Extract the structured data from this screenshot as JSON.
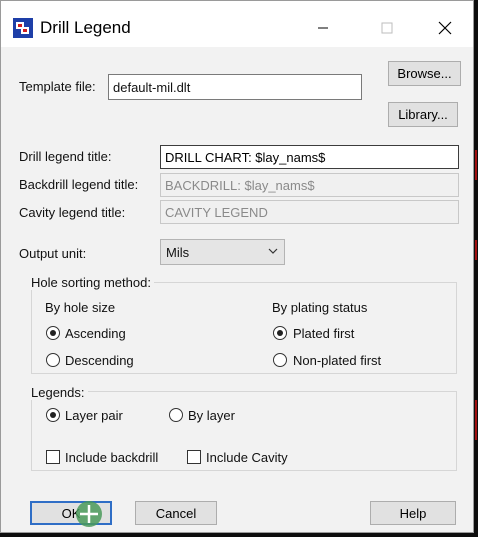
{
  "window": {
    "title": "Drill Legend",
    "minimize_icon": "minimize-icon",
    "maximize_icon": "maximize-icon",
    "close_icon": "close-icon"
  },
  "template": {
    "label": "Template file:",
    "value": "default-mil.dlt"
  },
  "buttons": {
    "browse": "Browse...",
    "library": "Library...",
    "ok": "OK",
    "cancel": "Cancel",
    "help": "Help"
  },
  "drill_legend": {
    "label": "Drill legend title:",
    "value": "DRILL CHART: $lay_nams$"
  },
  "backdrill_legend": {
    "label": "Backdrill legend title:",
    "value": "BACKDRILL: $lay_nams$"
  },
  "cavity_legend": {
    "label": "Cavity legend title:",
    "value": "CAVITY LEGEND"
  },
  "output_unit": {
    "label": "Output unit:",
    "value": "Mils"
  },
  "hole_sorting": {
    "title": "Hole sorting method:",
    "by_size": {
      "heading": "By hole size",
      "ascending": "Ascending",
      "descending": "Descending",
      "selected": "Ascending"
    },
    "by_plating": {
      "heading": "By plating status",
      "plated_first": "Plated first",
      "non_plated_first": "Non-plated first",
      "selected": "Plated first"
    }
  },
  "legends": {
    "title": "Legends:",
    "layer_pair": "Layer pair",
    "by_layer": "By layer",
    "selected": "Layer pair",
    "include_backdrill": {
      "label": "Include backdrill",
      "checked": false
    },
    "include_cavity": {
      "label": "Include Cavity",
      "checked": false
    }
  }
}
